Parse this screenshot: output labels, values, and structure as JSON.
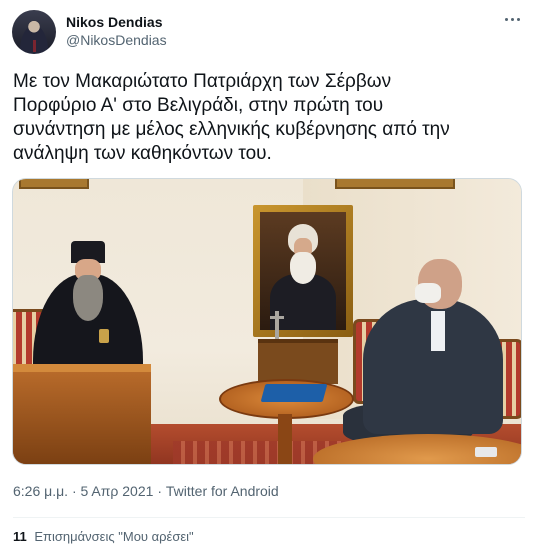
{
  "author": {
    "name": "Nikos Dendias",
    "handle": "@NikosDendias"
  },
  "tweet": {
    "text": "Με τον Μακαριώτατο Πατριάρχη των Σέρβων\nΠορφύριο Α' στο Βελιγράδι, στην πρώτη του\nσυνάντηση με μέλος ελληνικής κυβέρνησης από την\nανάληψη των καθηκόντων του."
  },
  "meta": {
    "time": "6:26 μ.μ.",
    "date": "5 Απρ 2021",
    "source": "Twitter for Android",
    "separator": "·"
  },
  "engagement": {
    "likes_count": "11",
    "likes_label": "Επισημάνσεις \"Μου αρέσει\""
  },
  "icons": {
    "more": "more-horizontal-icon"
  },
  "colors": {
    "text_primary": "#0f1419",
    "text_secondary": "#536471",
    "divider": "#eff3f4"
  }
}
